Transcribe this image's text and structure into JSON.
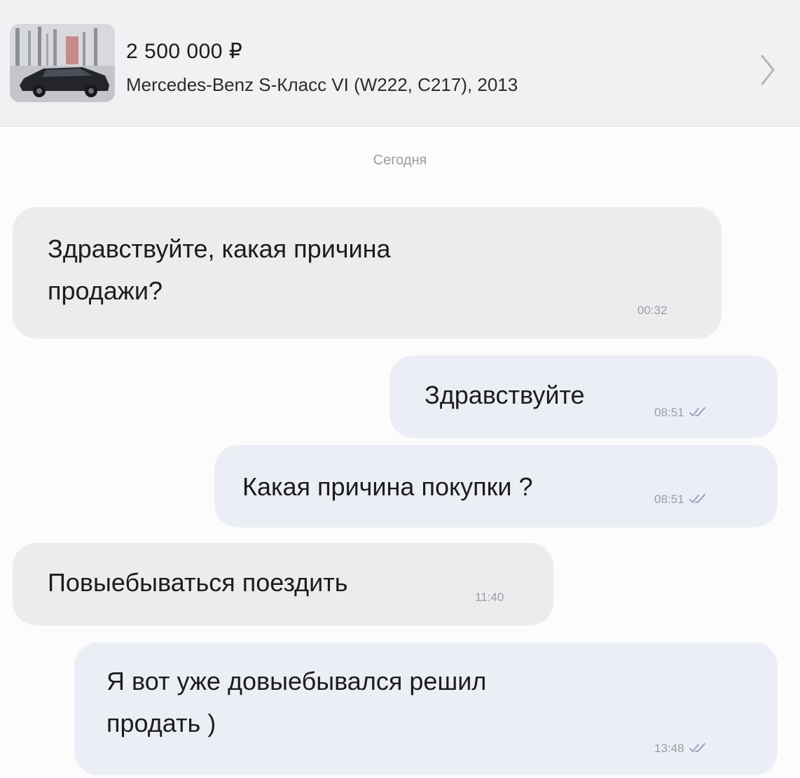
{
  "listing": {
    "price": "2 500 000 ₽",
    "title": "Mercedes-Benz S-Класс VI (W222, C217), 2013",
    "thumbnail_icon": "car-photo",
    "open_icon": "chevron-right-icon"
  },
  "date_separator": "Сегодня",
  "messages": [
    {
      "direction": "incoming",
      "text": "Здравствуйте, какая причина\nпродажи?",
      "time": "00:32",
      "read": false
    },
    {
      "direction": "outgoing",
      "text": "Здравствуйте",
      "time": "08:51",
      "read": true
    },
    {
      "direction": "outgoing",
      "text": "Какая причина покупки ?",
      "time": "08:51",
      "read": true
    },
    {
      "direction": "incoming",
      "text": "Повыебываться поездить",
      "time": "11:40",
      "read": false
    },
    {
      "direction": "outgoing",
      "text": "Я вот уже довыебывался решил\nпродать )",
      "time": "13:48",
      "read": true
    }
  ],
  "colors": {
    "incoming_bubble": "#ececef",
    "outgoing_bubble": "#eceef6",
    "read_ticks": "#8f9bb8"
  }
}
